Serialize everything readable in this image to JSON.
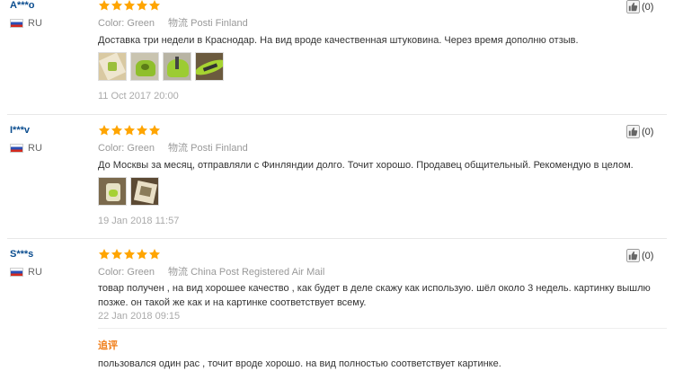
{
  "colors": {
    "star": "#ffa500",
    "name": "#0b4d8f",
    "followup": "#f07c16"
  },
  "reviews": [
    {
      "user": "A***o",
      "country": "RU",
      "color_label": "Color:",
      "color_value": "Green",
      "shipping_label": "物流",
      "shipping_value": "Posti Finland",
      "text": "Доставка три недели в Краснодар. На вид вроде качественная штуковина. Через время дополню отзыв.",
      "date": "11 Oct 2017 20:00",
      "helpful": "(0)",
      "stars": 5
    },
    {
      "user": "I***v",
      "country": "RU",
      "color_label": "Color:",
      "color_value": "Green",
      "shipping_label": "物流",
      "shipping_value": "Posti Finland",
      "text": "До Москвы за месяц, отправляли с Финляндии долго. Точит хорошо. Продавец общительный. Рекомендую в целом.",
      "date": "19 Jan 2018 11:57",
      "helpful": "(0)",
      "stars": 5
    },
    {
      "user": "S***s",
      "country": "RU",
      "color_label": "Color:",
      "color_value": "Green",
      "shipping_label": "物流",
      "shipping_value": "China Post Registered Air Mail",
      "text": "товар получен , на вид хорошее качество , как будет в деле скажу как использую. шёл около 3 недель. картинку вышлю позже. он такой же как и на картинке соответствует всему.",
      "date": "22 Jan 2018 09:15",
      "helpful": "(0)",
      "stars": 5,
      "followup_label": "追评",
      "followup_text": "пользовался один рас , точит вроде хорошо. на вид полностью соответствует картинке."
    }
  ]
}
